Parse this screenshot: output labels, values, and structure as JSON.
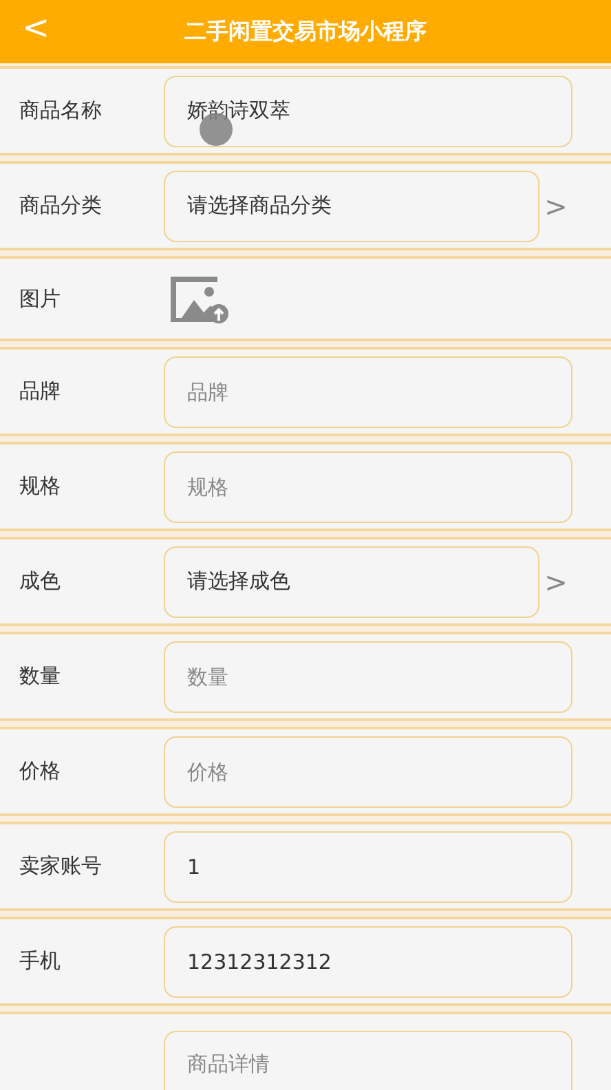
{
  "header": {
    "back": "<",
    "title": "二手闲置交易市场小程序"
  },
  "fields": [
    {
      "kind": "input",
      "label": "商品名称",
      "value": "娇韵诗双萃"
    },
    {
      "kind": "picker",
      "label": "商品分类",
      "value": "请选择商品分类",
      "arrow": ">"
    },
    {
      "kind": "image",
      "label": "图片"
    },
    {
      "kind": "input",
      "label": "品牌",
      "placeholder": "品牌"
    },
    {
      "kind": "input",
      "label": "规格",
      "placeholder": "规格"
    },
    {
      "kind": "picker",
      "label": "成色",
      "value": "请选择成色",
      "arrow": ">"
    },
    {
      "kind": "input",
      "label": "数量",
      "placeholder": "数量"
    },
    {
      "kind": "input",
      "label": "价格",
      "placeholder": "价格"
    },
    {
      "kind": "input",
      "label": "卖家账号",
      "value": "1"
    },
    {
      "kind": "input",
      "label": "手机",
      "value": "12312312312"
    },
    {
      "kind": "textarea",
      "placeholder": "商品详情"
    }
  ]
}
